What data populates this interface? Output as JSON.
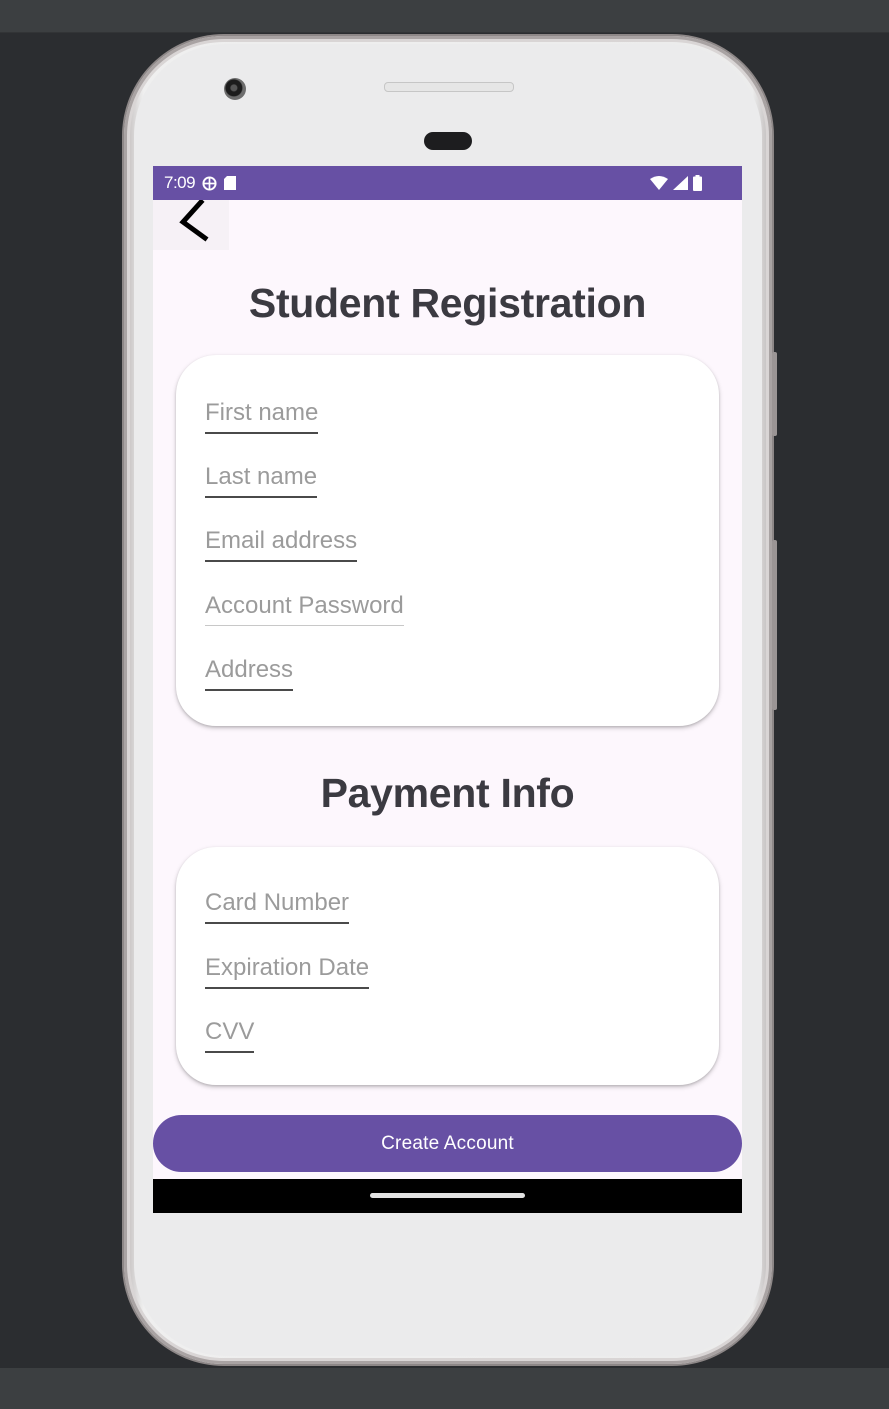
{
  "status_bar": {
    "time": "7:09",
    "icons": [
      "globe-icon",
      "sd-card-icon",
      "wifi-icon",
      "signal-icon",
      "battery-icon"
    ],
    "color": "#6750a4"
  },
  "nav": {
    "back_icon": "chevron-left-icon"
  },
  "registration": {
    "title": "Student Registration",
    "fields": [
      {
        "placeholder": "First name"
      },
      {
        "placeholder": "Last name"
      },
      {
        "placeholder": "Email address"
      },
      {
        "placeholder": "Account Password"
      },
      {
        "placeholder": "Address"
      }
    ]
  },
  "payment": {
    "title": "Payment Info",
    "fields": [
      {
        "placeholder": "Card Number"
      },
      {
        "placeholder": "Expiration Date"
      },
      {
        "placeholder": "CVV"
      }
    ]
  },
  "actions": {
    "create_account_label": "Create Account"
  },
  "theme": {
    "primary": "#6750a4",
    "background": "#fdf7fd",
    "heading": "#3b3a41"
  }
}
